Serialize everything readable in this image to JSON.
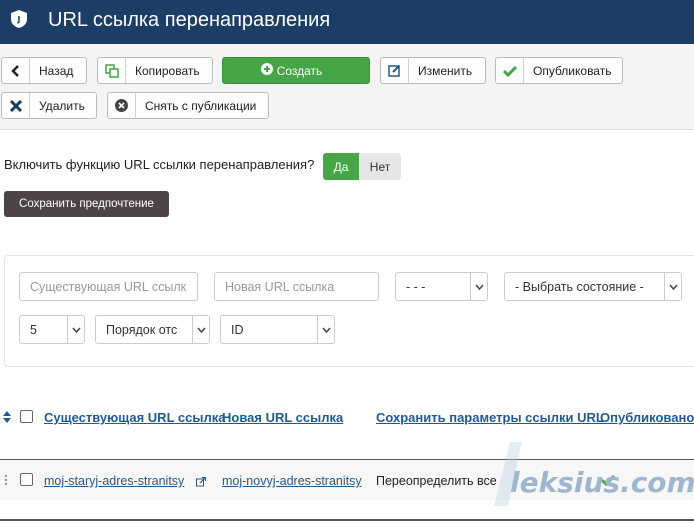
{
  "header": {
    "title": "URL ссылка перенаправления",
    "logo_icon": "joomla-logo-icon"
  },
  "toolbar": {
    "back": "Назад",
    "copy": "Копировать",
    "create": "Создать",
    "edit": "Изменить",
    "publish": "Опубликовать",
    "delete": "Удалить",
    "unpublish": "Снять с публикации"
  },
  "settings": {
    "question": "Включить функцию URL ссылки перенаправления?",
    "yes": "Да",
    "no": "Нет",
    "save_pref": "Сохранить предпочтение"
  },
  "filters": {
    "existing_placeholder": "Существующая URL ссылк",
    "new_placeholder": "Новая URL ссылка",
    "dash_select": "- - -",
    "state_select": "- Выбрать состояние -",
    "limit": "5",
    "order": "Порядок отс",
    "field": "ID"
  },
  "table": {
    "columns": [
      "Существующая URL ссылка",
      "Новая URL ссылка",
      "Сохранить параметры ссылки URL",
      "Опубликовано"
    ],
    "rows": [
      {
        "existing": "moj-staryj-adres-stranitsy",
        "new": "moj-novyj-adres-stranitsy",
        "params": "Переопределить все",
        "published": "check"
      }
    ]
  },
  "watermark": "leksius.com",
  "colors": {
    "header": "#1c3d66",
    "green": "#46a546",
    "link": "#1f5a92"
  }
}
